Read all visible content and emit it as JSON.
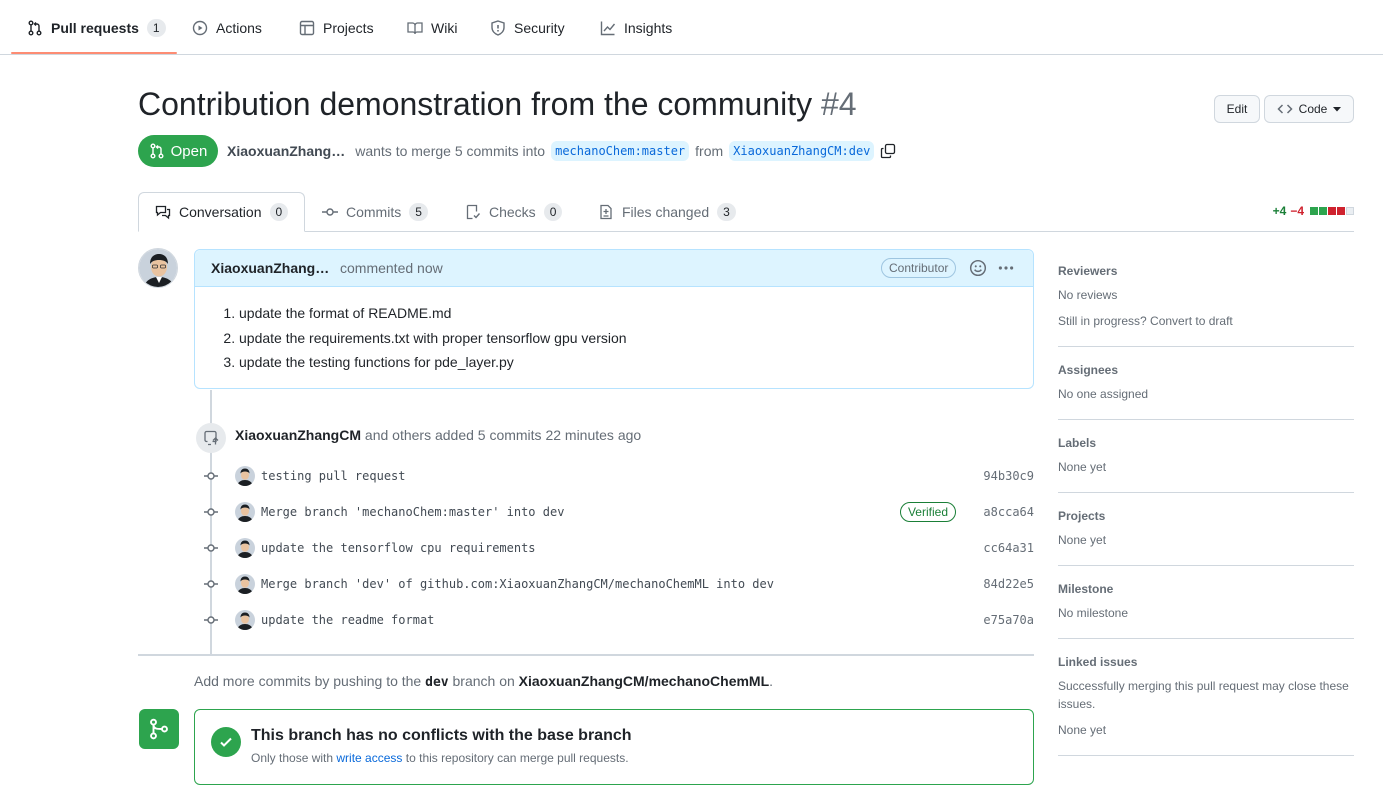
{
  "nav": {
    "items": [
      {
        "label": "Pull requests",
        "count": "1"
      },
      {
        "label": "Actions"
      },
      {
        "label": "Projects"
      },
      {
        "label": "Wiki"
      },
      {
        "label": "Security"
      },
      {
        "label": "Insights"
      }
    ]
  },
  "pr": {
    "title": "Contribution demonstration from the community",
    "number": "#4",
    "state": "Open",
    "author": "XiaoxuanZhang…",
    "merge_text": "wants to merge 5 commits into",
    "base_branch": "mechanoChem:master",
    "from_text": "from",
    "head_branch": "XiaoxuanZhangCM:dev"
  },
  "header_buttons": {
    "edit": "Edit",
    "code": "Code"
  },
  "tabs": [
    {
      "label": "Conversation",
      "count": "0"
    },
    {
      "label": "Commits",
      "count": "5"
    },
    {
      "label": "Checks",
      "count": "0"
    },
    {
      "label": "Files changed",
      "count": "3"
    }
  ],
  "diffstat": {
    "additions": "+4",
    "deletions": "−4",
    "colors": {
      "add": "#2da44e",
      "del": "#cf222e",
      "neutral": "#d0d7de"
    }
  },
  "comment": {
    "author": "XiaoxuanZhang…",
    "when": "commented now",
    "badge": "Contributor",
    "items": [
      "update the format of README.md",
      "update the requirements.txt with proper tensorflow gpu version",
      "update the testing functions for pde_layer.py"
    ]
  },
  "push_event": {
    "author": "XiaoxuanZhangCM",
    "text": "and others added 5 commits 22 minutes ago"
  },
  "commits": [
    {
      "message": "testing pull request",
      "sha": "94b30c9",
      "verified": ""
    },
    {
      "message": "Merge branch 'mechanoChem:master' into dev",
      "sha": "a8cca64",
      "verified": "Verified"
    },
    {
      "message": "update the tensorflow cpu requirements",
      "sha": "cc64a31",
      "verified": ""
    },
    {
      "message": "Merge branch 'dev' of github.com:XiaoxuanZhangCM/mechanoChemML into dev",
      "sha": "84d22e5",
      "verified": ""
    },
    {
      "message": "update the readme format",
      "sha": "e75a70a",
      "verified": ""
    }
  ],
  "hint": {
    "prefix": "Add more commits by pushing to the",
    "branch": "dev",
    "middle": "branch on",
    "repo": "XiaoxuanZhangCM/mechanoChemML",
    "suffix": "."
  },
  "merge": {
    "title": "This branch has no conflicts with the base branch",
    "sub_prefix": "Only those with",
    "sub_link": "write access",
    "sub_suffix": "to this repository can merge pull requests."
  },
  "sidebar": {
    "reviewers": {
      "heading": "Reviewers",
      "value": "No reviews",
      "extra": "Still in progress? Convert to draft"
    },
    "assignees": {
      "heading": "Assignees",
      "value": "No one assigned"
    },
    "labels": {
      "heading": "Labels",
      "value": "None yet"
    },
    "projects": {
      "heading": "Projects",
      "value": "None yet"
    },
    "milestone": {
      "heading": "Milestone",
      "value": "No milestone"
    },
    "linked_issues": {
      "heading": "Linked issues",
      "value": "Successfully merging this pull request may close these issues.",
      "extra": "None yet"
    }
  }
}
